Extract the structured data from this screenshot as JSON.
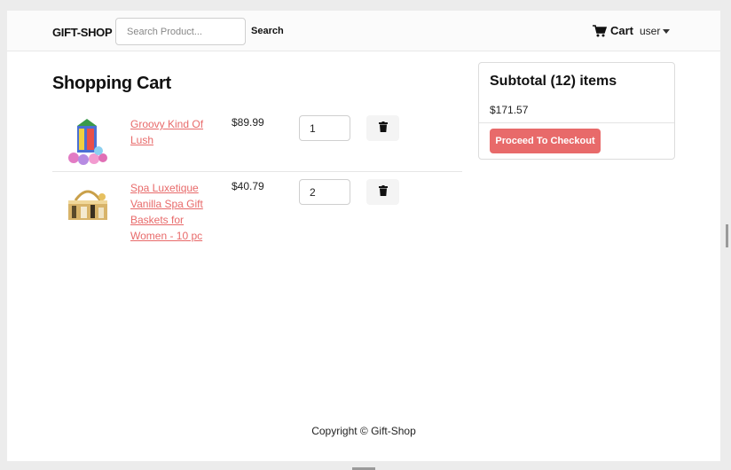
{
  "navbar": {
    "brand": "GIFT-SHOP",
    "search_placeholder": "Search Product...",
    "search_label": "Search",
    "cart_label": "Cart",
    "user_label": "user"
  },
  "cart": {
    "title": "Shopping Cart",
    "items": [
      {
        "name": "Groovy Kind Of Lush",
        "price": "$89.99",
        "qty": "1"
      },
      {
        "name": "Spa Luxetique Vanilla Spa Gift Baskets for Women - 10 pc",
        "price": "$40.79",
        "qty": "2"
      }
    ]
  },
  "summary": {
    "title": "Subtotal (12) items",
    "total": "$171.57",
    "checkout_label": "Proceed To Checkout"
  },
  "footer": {
    "copyright": "Copyright © Gift-Shop"
  },
  "icons": {
    "cart": "cart-icon",
    "delete": "trash-icon",
    "user_menu": "caret-down-icon"
  },
  "colors": {
    "accent": "#e86a6a",
    "navbar_bg": "#fbfbfb"
  }
}
